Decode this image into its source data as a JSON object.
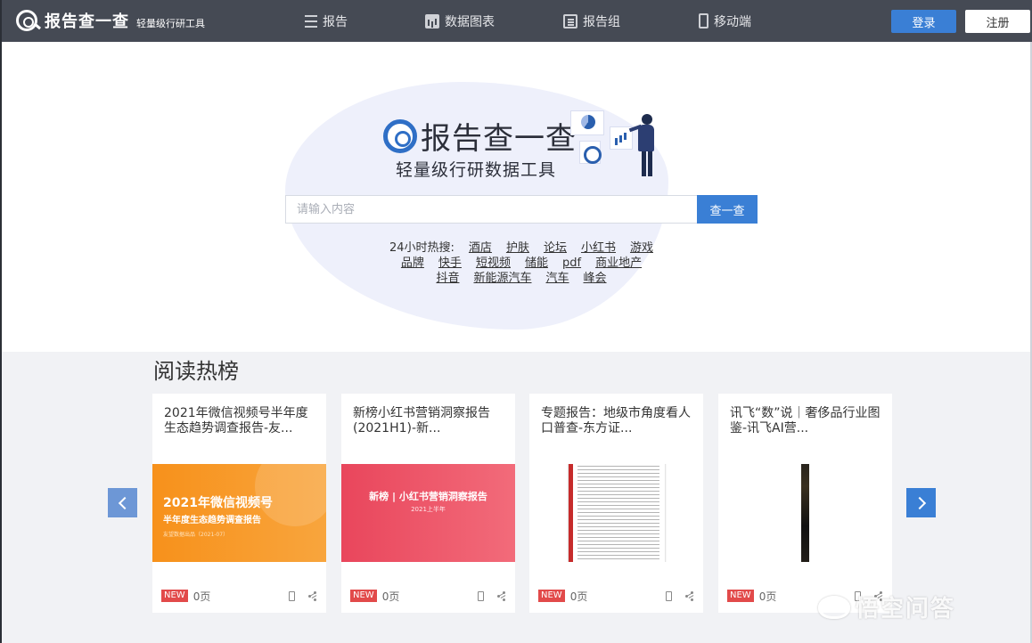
{
  "header": {
    "logo_title": "报告查一查",
    "logo_subtitle": "轻量级行研工具",
    "nav": [
      {
        "label": "报告",
        "icon": "list-icon"
      },
      {
        "label": "数据图表",
        "icon": "bar-chart-icon"
      },
      {
        "label": "报告组",
        "icon": "report-group-icon"
      },
      {
        "label": "移动端",
        "icon": "mobile-icon"
      }
    ],
    "login_label": "登录",
    "register_label": "注册"
  },
  "hero": {
    "title": "报告查一查",
    "subtitle": "轻量级行研数据工具",
    "search_placeholder": "请输入内容",
    "search_button": "查一查",
    "hot_label": "24小时热搜:",
    "hot_rows": [
      [
        "酒店",
        "护肤",
        "论坛",
        "小红书",
        "游戏"
      ],
      [
        "品牌",
        "快手",
        "短视频",
        "储能",
        "pdf",
        "商业地产"
      ],
      [
        "抖音",
        "新能源汽车",
        "汽车",
        "峰会"
      ]
    ]
  },
  "reading": {
    "section_title": "阅读热榜",
    "cards": [
      {
        "title": "2021年微信视频号半年度生态趋势调查报告-友...",
        "cover_line1": "2021年微信视频号",
        "cover_line2": "半年度生态趋势调查报告",
        "cover_line3": "友望数据出品（2021-07）",
        "badge": "NEW",
        "pages": "0页"
      },
      {
        "title": "新榜小红书营销洞察报告(2021H1)-新...",
        "cover_line1": "新榜 | 小红书营销洞察报告",
        "cover_line2": "2021上半年",
        "badge": "NEW",
        "pages": "0页"
      },
      {
        "title": "专题报告：地级市角度看人口普查-东方证...",
        "badge": "NEW",
        "pages": "0页"
      },
      {
        "title": "讯飞“数”说｜奢侈品行业图鉴-讯飞AI营...",
        "badge": "NEW",
        "pages": "0页"
      }
    ]
  },
  "watermark": {
    "text": "悟空问答"
  },
  "colors": {
    "topbar": "#454a54",
    "accent": "#3a7fd5",
    "badge": "#e24a4a",
    "section_bg": "#f1f2f5"
  }
}
